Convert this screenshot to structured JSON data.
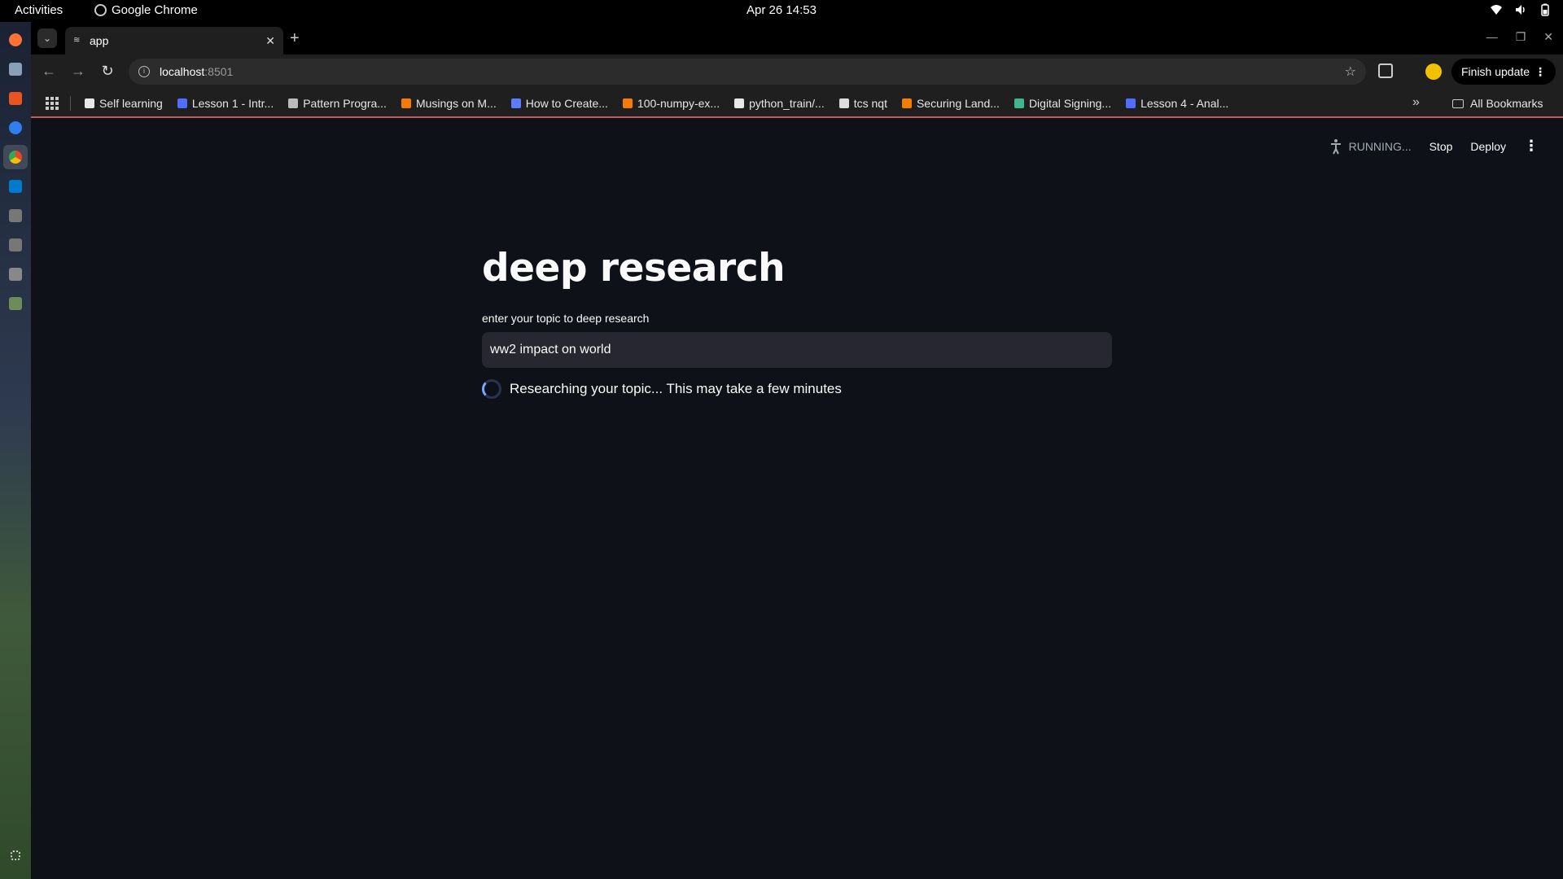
{
  "system": {
    "activities_label": "Activities",
    "app_name": "Google Chrome",
    "clock": "Apr 26  14:53"
  },
  "browser": {
    "tab_title": "app",
    "url_host": "localhost",
    "url_port": ":8501",
    "finish_update_label": "Finish update",
    "bookmarks": [
      {
        "label": "Self learning",
        "color": "#e8e8e8"
      },
      {
        "label": "Lesson 1 - Intr...",
        "color": "#4f6dff"
      },
      {
        "label": "Pattern Progra...",
        "color": "#bbbbbb"
      },
      {
        "label": "Musings on M...",
        "color": "#f57c00"
      },
      {
        "label": "How to Create...",
        "color": "#5c7cfa"
      },
      {
        "label": "100-numpy-ex...",
        "color": "#f57c00"
      },
      {
        "label": "python_train/...",
        "color": "#e8e8e8"
      },
      {
        "label": "tcs nqt",
        "color": "#dddddd"
      },
      {
        "label": "Securing Land...",
        "color": "#f57c00"
      },
      {
        "label": "Digital Signing...",
        "color": "#3fb68b"
      },
      {
        "label": "Lesson 4 - Anal...",
        "color": "#4f6dff"
      }
    ],
    "all_bookmarks_label": "All Bookmarks"
  },
  "app": {
    "status_label": "RUNNING...",
    "stop_label": "Stop",
    "deploy_label": "Deploy",
    "title": "deep research",
    "input_label": "enter your topic to deep research",
    "input_value": "ww2 impact on world",
    "spinner_text": "Researching your topic... This may take a few minutes"
  }
}
